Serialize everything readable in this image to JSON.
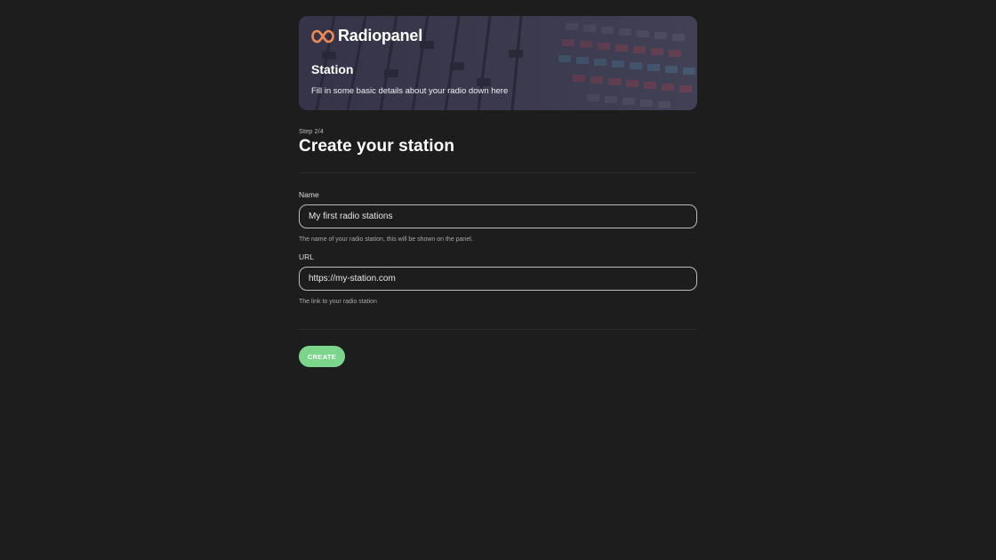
{
  "header": {
    "brand_name": "Radiopanel",
    "brand_color": "#f08a55",
    "title": "Station",
    "subtitle": "Fill in some basic details about your radio down here"
  },
  "wizard": {
    "step": "Step 2/4",
    "title": "Create your station"
  },
  "form": {
    "name_label": "Name",
    "name_value": "My first radio stations",
    "name_help": "The name of your radio station, this will be shown on the panel.",
    "url_label": "URL",
    "url_value": "https://my-station.com",
    "url_help": "The link to your radio station"
  },
  "actions": {
    "create_label": "CREATE",
    "create_color": "#7bd68b"
  },
  "icons": {
    "logo": "infinity-logo-icon"
  },
  "colors": {
    "background": "#1d1d1d",
    "text": "#ffffff"
  }
}
